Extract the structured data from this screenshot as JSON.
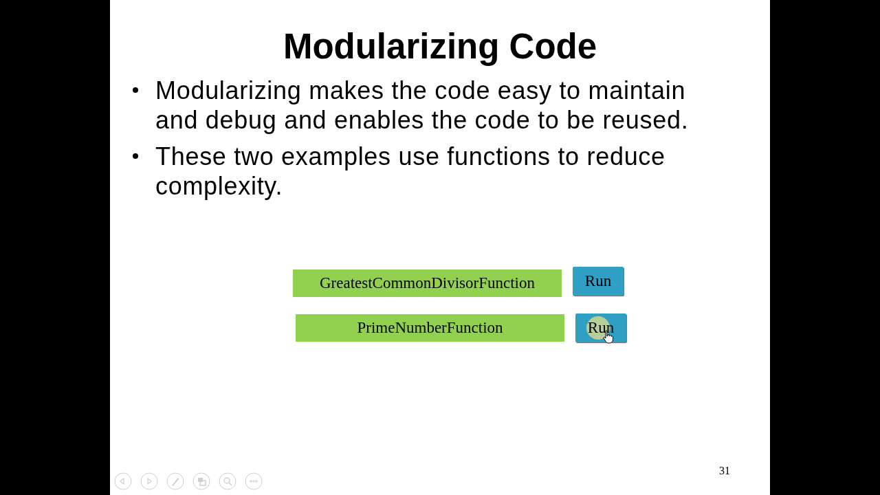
{
  "slide": {
    "title": "Modularizing Code",
    "bullets": [
      "Modularizing makes the code easy to maintain and debug and enables the code to be reused.",
      "These two examples use functions to reduce complexity."
    ],
    "examples": [
      {
        "label": "GreatestCommonDivisorFunction",
        "button": "Run",
        "highlighted": false
      },
      {
        "label": "PrimeNumberFunction",
        "button": "Run",
        "highlighted": true
      }
    ],
    "slide_number": "31"
  },
  "toolbar": [
    {
      "kind": "previous"
    },
    {
      "kind": "next"
    },
    {
      "kind": "pen"
    },
    {
      "kind": "slides"
    },
    {
      "kind": "zoom"
    },
    {
      "kind": "more"
    }
  ]
}
